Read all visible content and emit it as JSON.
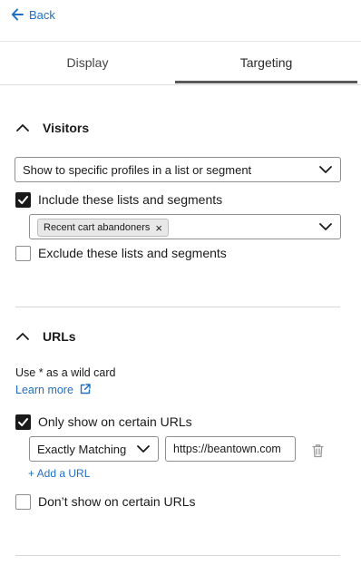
{
  "nav": {
    "back_label": "Back"
  },
  "tabs": [
    {
      "label": "Display",
      "active": false
    },
    {
      "label": "Targeting",
      "active": true
    }
  ],
  "visitors": {
    "title": "Visitors",
    "audience_select": "Show to specific profiles in a list or segment",
    "include_checkbox": {
      "label": "Include these lists and segments",
      "checked": true
    },
    "included_tags": [
      "Recent cart abandoners"
    ],
    "exclude_checkbox": {
      "label": "Exclude these lists and segments",
      "checked": false
    }
  },
  "urls": {
    "title": "URLs",
    "hint": "Use * as a wild card",
    "learn_more": "Learn more",
    "only_show_checkbox": {
      "label": "Only show on certain URLs",
      "checked": true
    },
    "match_type": "Exactly Matching",
    "url_value": "https://beantown.com",
    "add_url": "+ Add a URL",
    "dont_show_checkbox": {
      "label": "Don’t show on certain URLs",
      "checked": false
    }
  },
  "colors": {
    "link": "#1f6fc5",
    "checkbox_checked": "#1a1a1a",
    "tab_underline": "#5a5a5a"
  },
  "icons": [
    "arrow-left-icon",
    "chevron-up-icon",
    "chevron-down-icon",
    "close-icon",
    "external-link-icon",
    "check-icon",
    "trash-icon"
  ]
}
